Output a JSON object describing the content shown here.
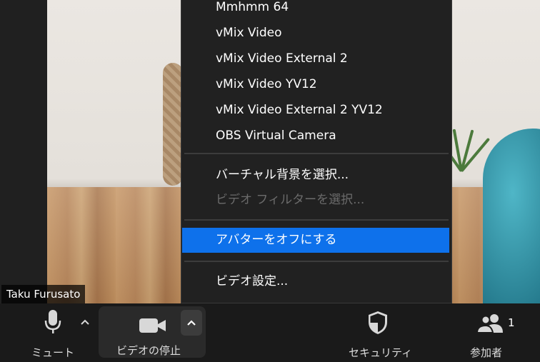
{
  "participant": {
    "name": "Taku Furusato"
  },
  "camera_menu": {
    "cameras": [
      "Mmhmm 64",
      "vMix Video",
      "vMix Video External 2",
      "vMix Video YV12",
      "vMix Video External 2 YV12",
      "OBS Virtual Camera"
    ],
    "virtual_background": "バーチャル背景を選択...",
    "video_filter": "ビデオ フィルターを選択...",
    "avatar_off": "アバターをオフにする",
    "video_settings": "ビデオ設定..."
  },
  "toolbar": {
    "mute_label": "ミュート",
    "stop_video_label": "ビデオの停止",
    "security_label": "セキュリティ",
    "participants_label": "参加者",
    "participants_count": "1"
  },
  "colors": {
    "highlight": "#0e71eb",
    "menu_bg": "#212121",
    "toolbar_bg": "#1a1a1a"
  }
}
